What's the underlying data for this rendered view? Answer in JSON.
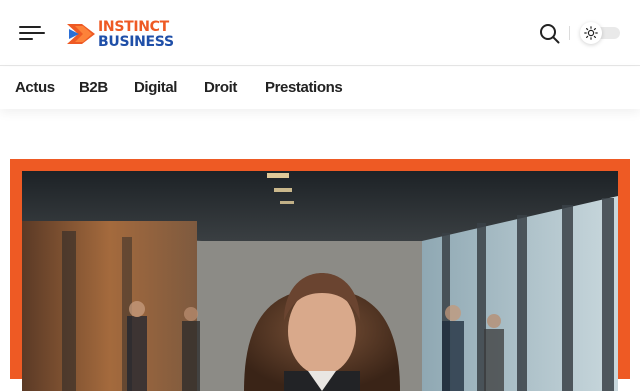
{
  "header": {
    "logo": {
      "line1": "INSTINCT",
      "line2": "BUSINESS"
    },
    "menu_icon": "hamburger-menu-icon",
    "search_icon": "search-icon",
    "theme_icon": "sun-icon"
  },
  "nav": {
    "items": [
      {
        "label": "Actus"
      },
      {
        "label": "B2B"
      },
      {
        "label": "Digital"
      },
      {
        "label": "Droit"
      },
      {
        "label": "Prestations"
      }
    ]
  },
  "colors": {
    "accent": "#ee5a24",
    "brand_blue": "#1f4fa8",
    "text": "#222222"
  }
}
